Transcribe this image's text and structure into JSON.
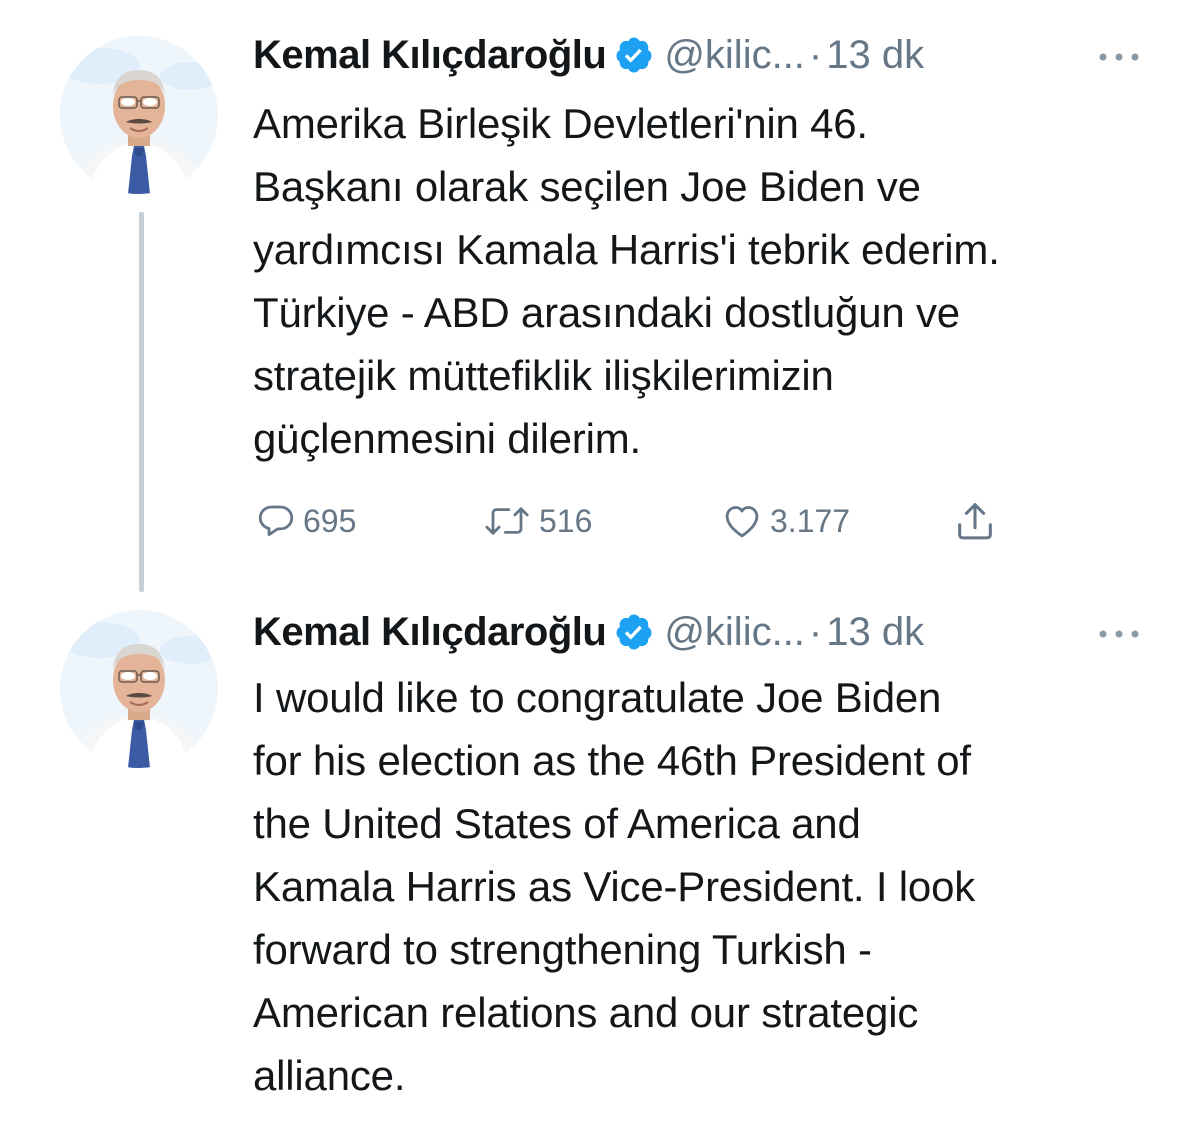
{
  "tweets": [
    {
      "author_name": "Kemal Kılıçdaroğlu",
      "handle": "@kilic...",
      "dot": "·",
      "time": "13 dk",
      "verified": true,
      "text_lines": [
        "Amerika Birleşik Devletleri'nin 46.",
        "Başkanı olarak seçilen Joe Biden ve",
        "yardımcısı Kamala Harris'i tebrik ederim.",
        "Türkiye - ABD arasındaki dostluğun ve",
        "stratejik müttefiklik ilişkilerimizin",
        "güçlenmesini dilerim."
      ],
      "actions": {
        "replies": "695",
        "retweets": "516",
        "likes": "3.177"
      }
    },
    {
      "author_name": "Kemal Kılıçdaroğlu",
      "handle": "@kilic...",
      "dot": "·",
      "time": "13 dk",
      "verified": true,
      "text_lines": [
        "I would like to congratulate Joe Biden",
        "for his election as the 46th President of",
        "the United States of America and",
        "Kamala Harris as Vice-President. I look",
        "forward to strengthening Turkish -",
        "American relations and our strategic",
        "alliance."
      ]
    }
  ],
  "icons": {
    "verified": "verified-badge-icon",
    "more": "more-dots-icon",
    "reply": "reply-bubble-icon",
    "retweet": "retweet-arrows-icon",
    "like": "heart-icon",
    "share": "share-upload-icon"
  },
  "colors": {
    "text": "#14171a",
    "secondary": "#657786",
    "verified": "#1da1f2",
    "thread_line": "#c4cfd6"
  }
}
